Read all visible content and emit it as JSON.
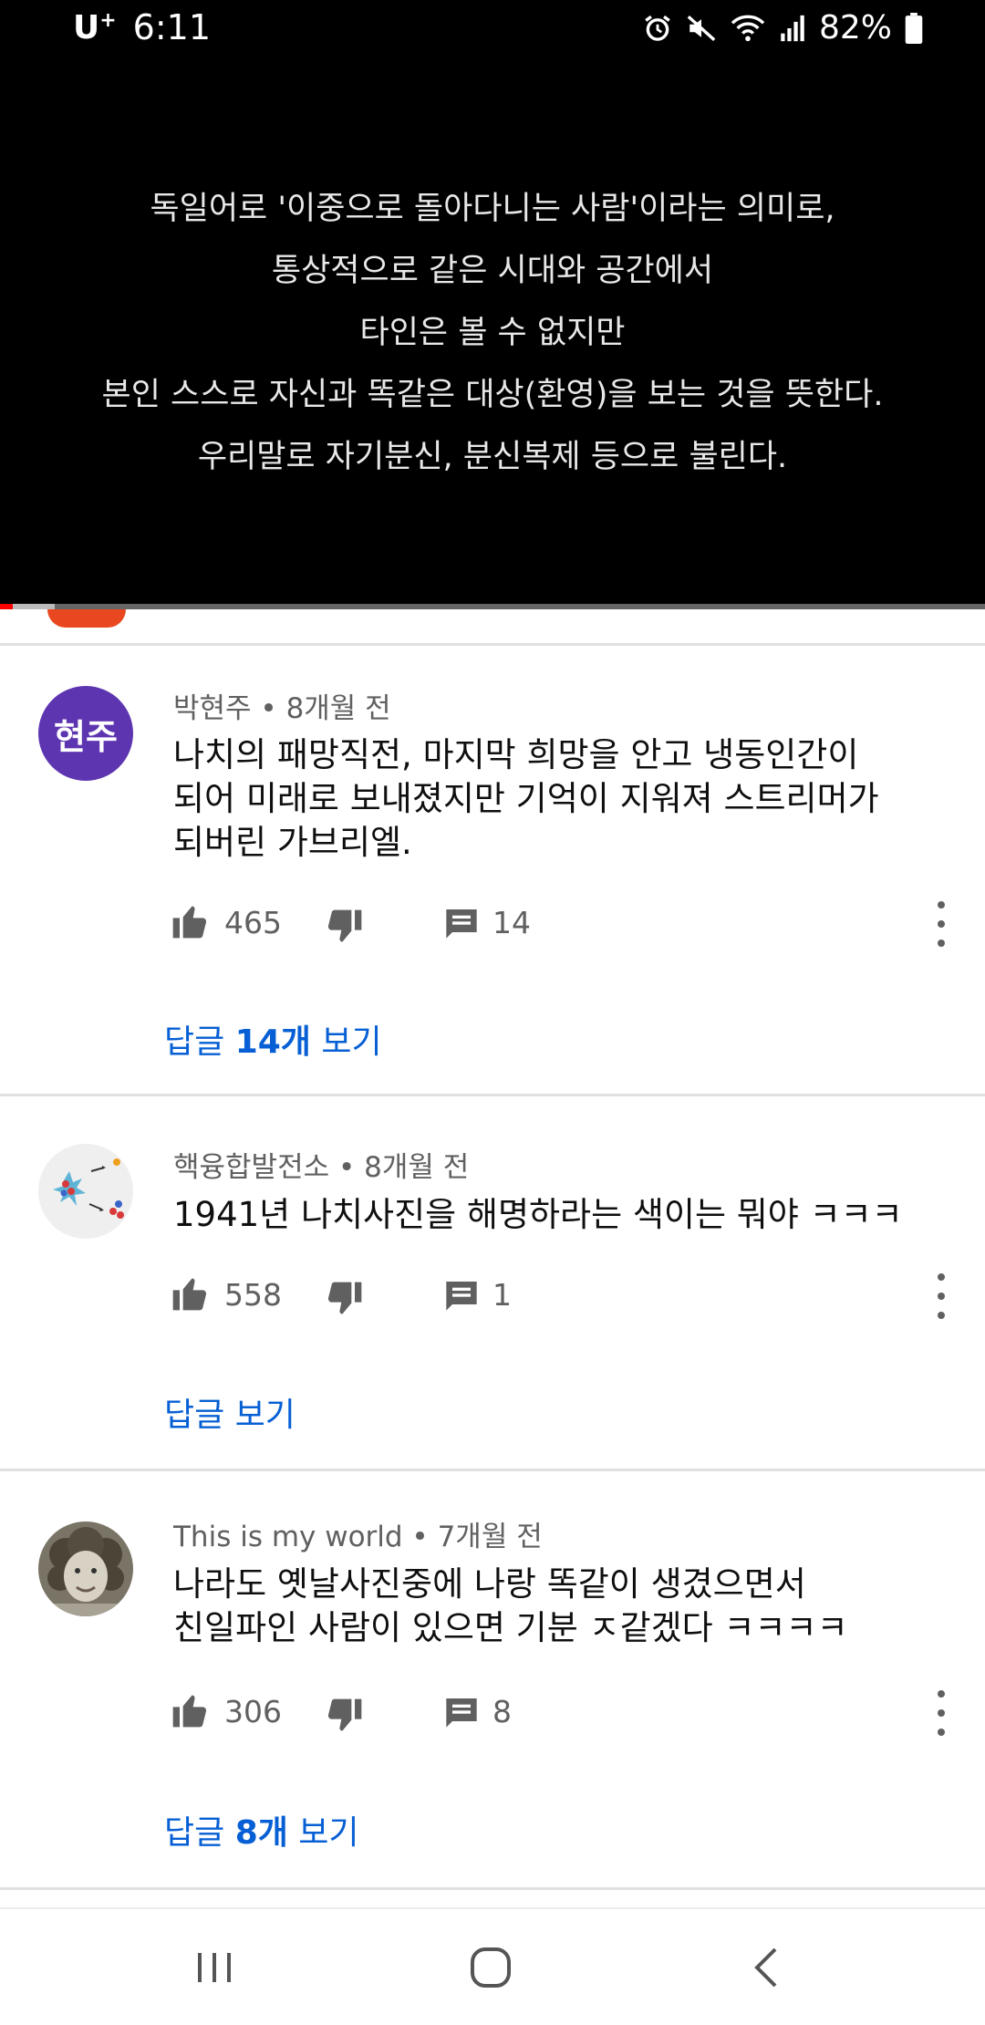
{
  "status_bar": {
    "carrier": "U",
    "carrier_sup": "+",
    "time": "6:11",
    "battery": "82%",
    "icons": [
      "alarm-icon",
      "mute-icon",
      "wifi-icon",
      "signal-icon",
      "battery-icon"
    ]
  },
  "video": {
    "subtitle_lines": [
      "독일어로 '이중으로 돌아다니는 사람'이라는 의미로,",
      "통상적으로 같은 시대와 공간에서",
      "타인은 볼 수 없지만",
      "본인 스스로 자신과 똑같은 대상(환영)을 보는 것을 뜻한다.",
      "우리말로 자기분신, 분신복제 등으로 불린다."
    ],
    "progress_fraction": 0.013
  },
  "comments": [
    {
      "author": "박현주",
      "time": "8개월 전",
      "avatar_text": "현주",
      "text_lines": [
        "나치의 패망직전, 마지막 희망을 안고 냉동인간이",
        "되어 미래로 보내졌지만 기억이 지워져 스트리머가",
        "되버린 가브리엘."
      ],
      "likes": "465",
      "replies": "14",
      "view_replies": {
        "prefix": "답글 ",
        "count": "14개",
        "suffix": " 보기"
      }
    },
    {
      "author": "핵융합발전소",
      "time": "8개월 전",
      "avatar_text": "",
      "text_lines": [
        "1941년 나치사진을 해명하라는 색이는 뭐야 ㅋㅋㅋ"
      ],
      "likes": "558",
      "replies": "1",
      "view_replies": {
        "prefix": "답글 보기",
        "count": "",
        "suffix": ""
      }
    },
    {
      "author": "This is my world",
      "time": "7개월 전",
      "avatar_text": "",
      "text_lines": [
        "나라도 옛날사진중에 나랑 똑같이 생겼으면서",
        "친일파인 사람이 있으면 기분 ㅈ같겠다 ㅋㅋㅋㅋ"
      ],
      "likes": "306",
      "replies": "8",
      "view_replies": {
        "prefix": "답글 ",
        "count": "8개",
        "suffix": " 보기"
      }
    }
  ],
  "separator": " • ",
  "colors": {
    "link": "#065fd4",
    "avatar_purple": "#5e35b1",
    "progress_red": "#ff0000"
  },
  "navbar": [
    "recents-icon",
    "home-icon",
    "back-icon"
  ]
}
